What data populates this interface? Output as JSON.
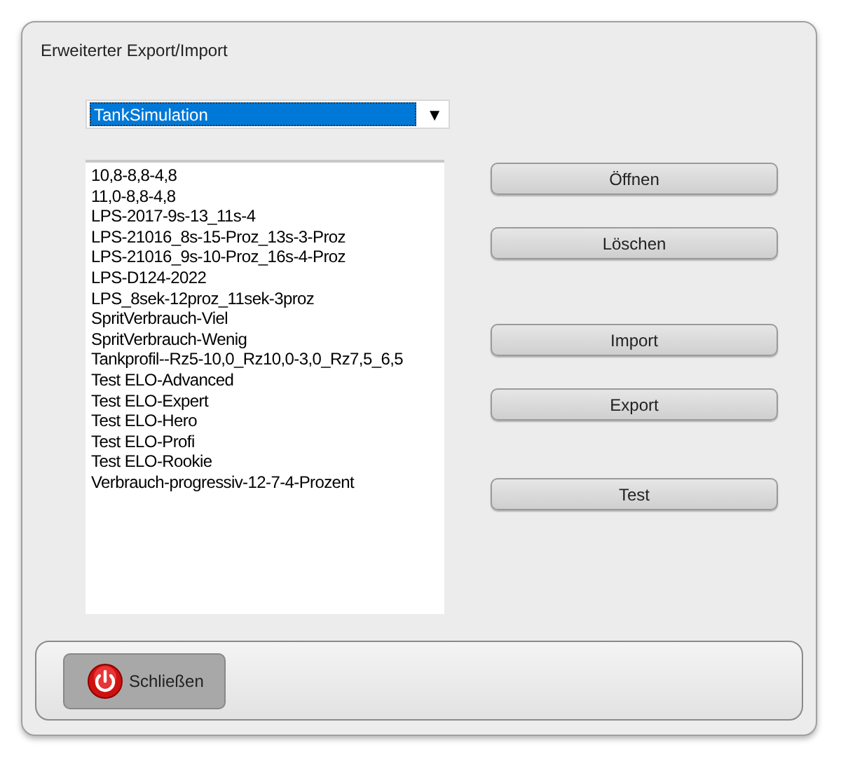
{
  "window": {
    "title": "Erweiterter Export/Import"
  },
  "dropdown": {
    "value": "TankSimulation",
    "arrow": "▼"
  },
  "list": {
    "items": [
      "10,8-8,8-4,8",
      "11,0-8,8-4,8",
      "LPS-2017-9s-13_11s-4",
      "LPS-21016_8s-15-Proz_13s-3-Proz",
      "LPS-21016_9s-10-Proz_16s-4-Proz",
      "LPS-D124-2022",
      "LPS_8sek-12proz_11sek-3proz",
      "SpritVerbrauch-Viel",
      "SpritVerbrauch-Wenig",
      "Tankprofil--Rz5-10,0_Rz10,0-3,0_Rz7,5_6,5",
      "Test ELO-Advanced",
      "Test ELO-Expert",
      "Test ELO-Hero",
      "Test ELO-Profi",
      "Test ELO-Rookie",
      "Verbrauch-progressiv-12-7-4-Prozent"
    ]
  },
  "buttons": [
    "Öffnen",
    "Löschen",
    "Import",
    "Export",
    "Test"
  ],
  "footer": {
    "close_button": "Schließen"
  }
}
